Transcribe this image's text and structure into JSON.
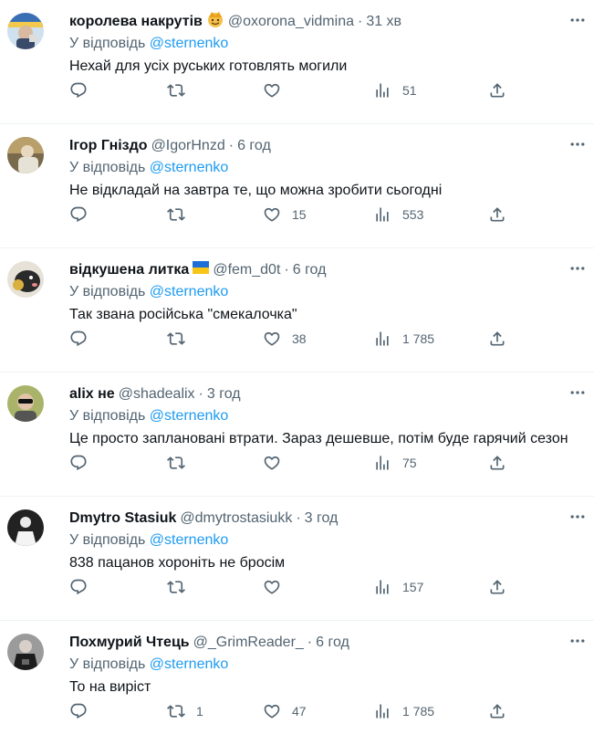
{
  "reply_prefix": "У відповідь",
  "tweets": [
    {
      "name": "королева накрутів",
      "badge": "emoji",
      "handle": "@oxorona_vidmina",
      "time": "31 хв",
      "mention": "@sternenko",
      "text": "Нехай для усіх руських готовлять могили",
      "retweets": "",
      "likes": "",
      "views": "51"
    },
    {
      "name": "Ігор Гніздо",
      "badge": "",
      "handle": "@IgorHnzd",
      "time": "6 год",
      "mention": "@sternenko",
      "text": "Не відкладай на завтра те, що можна зробити сьогодні",
      "retweets": "",
      "likes": "15",
      "views": "553"
    },
    {
      "name": "відкушена литка",
      "badge": "flag-ua",
      "handle": "@fem_d0t",
      "time": "6 год",
      "mention": "@sternenko",
      "text": "Так звана російська \"смекалочка\"",
      "retweets": "",
      "likes": "38",
      "views": "1 785"
    },
    {
      "name": "alix не",
      "badge": "",
      "handle": "@shadealix",
      "time": "3 год",
      "mention": "@sternenko",
      "text": "Це просто заплановані втрати. Зараз дешевше, потім буде гарячий сезон",
      "retweets": "",
      "likes": "",
      "views": "75"
    },
    {
      "name": "Dmytro Stasiuk",
      "badge": "",
      "handle": "@dmytrostasiukk",
      "time": "3 год",
      "mention": "@sternenko",
      "text": "838 пацанов хороніть не бросім",
      "retweets": "",
      "likes": "",
      "views": "157"
    },
    {
      "name": "Похмурий Чтець",
      "badge": "",
      "handle": "@_GrimReader_",
      "time": "6 год",
      "mention": "@sternenko",
      "text": "То на виріст",
      "retweets": "1",
      "likes": "47",
      "views": "1 785"
    }
  ],
  "icons": {
    "reply": "reply-icon",
    "retweet": "retweet-icon",
    "like": "heart-icon",
    "views": "views-icon",
    "share": "share-icon",
    "more": "more-icon"
  },
  "colors": {
    "text": "#0f1419",
    "secondary": "#536471",
    "accent": "#1d9bf0",
    "divider": "#eff3f4"
  }
}
